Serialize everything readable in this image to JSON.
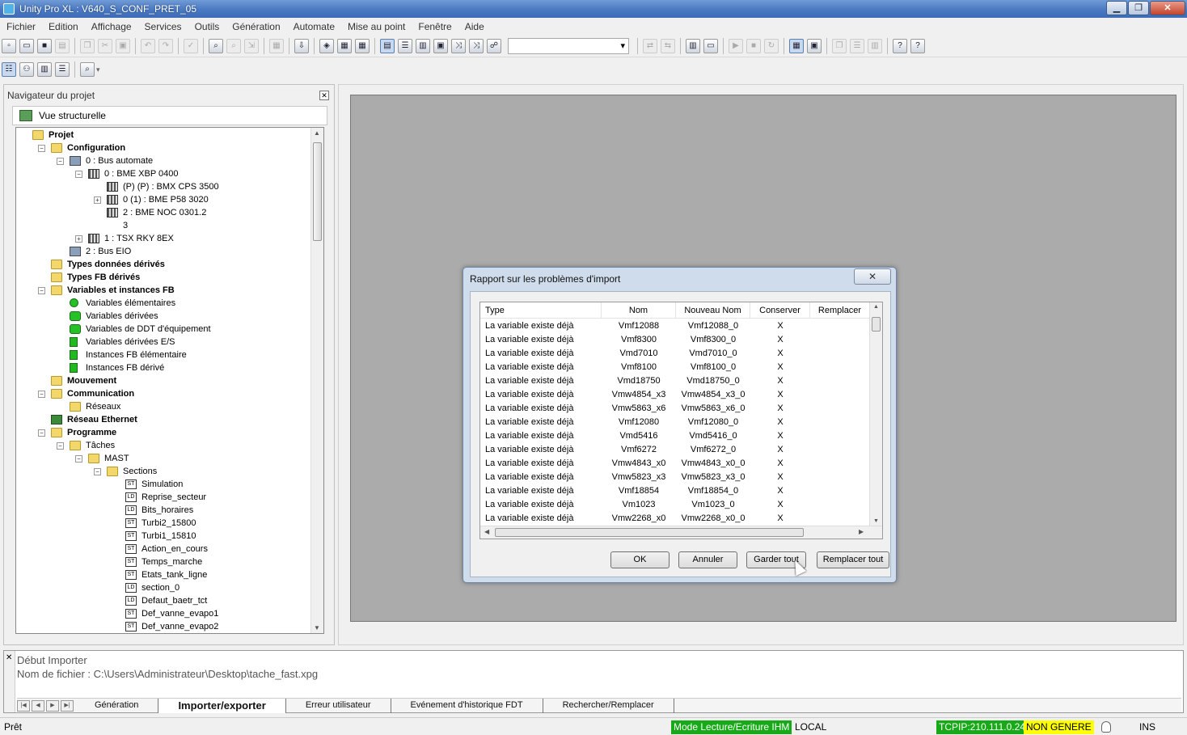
{
  "window": {
    "title": "Unity Pro XL : V640_S_CONF_PRET_05"
  },
  "menu": [
    "Fichier",
    "Edition",
    "Affichage",
    "Services",
    "Outils",
    "Génération",
    "Automate",
    "Mise au point",
    "Fenêtre",
    "Aide"
  ],
  "navigator": {
    "title": "Navigateur du projet",
    "view": "Vue structurelle",
    "tree": [
      {
        "label": "Projet",
        "level": 0,
        "icon": "folder",
        "bold": true
      },
      {
        "label": "Configuration",
        "level": 1,
        "icon": "folder",
        "bold": true,
        "exp": "-"
      },
      {
        "label": "0 : Bus automate",
        "level": 2,
        "icon": "bus",
        "exp": "-"
      },
      {
        "label": "0 : BME XBP 0400",
        "level": 3,
        "icon": "rack",
        "exp": "-"
      },
      {
        "label": "(P) (P) : BMX CPS 3500",
        "level": 4,
        "icon": "rack"
      },
      {
        "label": "0 (1) : BME P58 3020",
        "level": 4,
        "icon": "rack",
        "exp": "+"
      },
      {
        "label": "2 : BME NOC 0301.2",
        "level": 4,
        "icon": "rack"
      },
      {
        "label": "3",
        "level": 4,
        "icon": "none"
      },
      {
        "label": "1 : TSX RKY 8EX",
        "level": 3,
        "icon": "rack",
        "exp": "+"
      },
      {
        "label": "2 : Bus EIO",
        "level": 2,
        "icon": "bus"
      },
      {
        "label": "Types données dérivés",
        "level": 1,
        "icon": "folder",
        "bold": true
      },
      {
        "label": "Types FB dérivés",
        "level": 1,
        "icon": "folder",
        "bold": true
      },
      {
        "label": "Variables et instances FB",
        "level": 1,
        "icon": "folder",
        "bold": true,
        "exp": "-"
      },
      {
        "label": "Variables élémentaires",
        "level": 2,
        "icon": "greenc"
      },
      {
        "label": "Variables dérivées",
        "level": 2,
        "icon": "greenr"
      },
      {
        "label": "Variables de DDT d'équipement",
        "level": 2,
        "icon": "greenr"
      },
      {
        "label": "Variables dérivées E/S",
        "level": 2,
        "icon": "greens"
      },
      {
        "label": "Instances FB élémentaire",
        "level": 2,
        "icon": "greens"
      },
      {
        "label": "Instances FB dérivé",
        "level": 2,
        "icon": "greens"
      },
      {
        "label": "Mouvement",
        "level": 1,
        "icon": "folder",
        "bold": true
      },
      {
        "label": "Communication",
        "level": 1,
        "icon": "folder",
        "bold": true,
        "exp": "-"
      },
      {
        "label": "Réseaux",
        "level": 2,
        "icon": "folder"
      },
      {
        "label": "Réseau Ethernet",
        "level": 1,
        "icon": "net",
        "bold": true
      },
      {
        "label": "Programme",
        "level": 1,
        "icon": "folder",
        "bold": true,
        "exp": "-"
      },
      {
        "label": "Tâches",
        "level": 2,
        "icon": "folder",
        "exp": "-"
      },
      {
        "label": "MAST",
        "level": 3,
        "icon": "folder",
        "exp": "-"
      },
      {
        "label": "Sections",
        "level": 4,
        "icon": "folder",
        "exp": "-"
      },
      {
        "label": "Simulation",
        "level": 5,
        "icon": "ST"
      },
      {
        "label": "Reprise_secteur",
        "level": 5,
        "icon": "LD"
      },
      {
        "label": "Bits_horaires",
        "level": 5,
        "icon": "LD"
      },
      {
        "label": "Turbi2_15800",
        "level": 5,
        "icon": "ST"
      },
      {
        "label": "Turbi1_15810",
        "level": 5,
        "icon": "ST"
      },
      {
        "label": "Action_en_cours",
        "level": 5,
        "icon": "ST"
      },
      {
        "label": "Temps_marche",
        "level": 5,
        "icon": "ST"
      },
      {
        "label": "Etats_tank_ligne",
        "level": 5,
        "icon": "ST"
      },
      {
        "label": "section_0",
        "level": 5,
        "icon": "LD"
      },
      {
        "label": "Defaut_baetr_tct",
        "level": 5,
        "icon": "LD"
      },
      {
        "label": "Def_vanne_evapo1",
        "level": 5,
        "icon": "ST"
      },
      {
        "label": "Def_vanne_evapo2",
        "level": 5,
        "icon": "ST"
      }
    ]
  },
  "dialog": {
    "title": "Rapport sur les problèmes d'import",
    "close": "✕",
    "columns": [
      "Type",
      "Nom",
      "Nouveau Nom",
      "Conserver",
      "Remplacer"
    ],
    "rows": [
      [
        "La variable existe déjà",
        "Vmf12088",
        "Vmf12088_0",
        "X",
        ""
      ],
      [
        "La variable existe déjà",
        "Vmf8300",
        "Vmf8300_0",
        "X",
        ""
      ],
      [
        "La variable existe déjà",
        "Vmd7010",
        "Vmd7010_0",
        "X",
        ""
      ],
      [
        "La variable existe déjà",
        "Vmf8100",
        "Vmf8100_0",
        "X",
        ""
      ],
      [
        "La variable existe déjà",
        "Vmd18750",
        "Vmd18750_0",
        "X",
        ""
      ],
      [
        "La variable existe déjà",
        "Vmw4854_x3",
        "Vmw4854_x3_0",
        "X",
        ""
      ],
      [
        "La variable existe déjà",
        "Vmw5863_x6",
        "Vmw5863_x6_0",
        "X",
        ""
      ],
      [
        "La variable existe déjà",
        "Vmf12080",
        "Vmf12080_0",
        "X",
        ""
      ],
      [
        "La variable existe déjà",
        "Vmd5416",
        "Vmd5416_0",
        "X",
        ""
      ],
      [
        "La variable existe déjà",
        "Vmf6272",
        "Vmf6272_0",
        "X",
        ""
      ],
      [
        "La variable existe déjà",
        "Vmw4843_x0",
        "Vmw4843_x0_0",
        "X",
        ""
      ],
      [
        "La variable existe déjà",
        "Vmw5823_x3",
        "Vmw5823_x3_0",
        "X",
        ""
      ],
      [
        "La variable existe déjà",
        "Vmf18854",
        "Vmf18854_0",
        "X",
        ""
      ],
      [
        "La variable existe déjà",
        "Vm1023",
        "Vm1023_0",
        "X",
        ""
      ],
      [
        "La variable existe déjà",
        "Vmw2268_x0",
        "Vmw2268_x0_0",
        "X",
        ""
      ]
    ],
    "buttons": {
      "ok": "OK",
      "cancel": "Annuler",
      "keep_all": "Garder tout",
      "replace_all": "Remplacer tout"
    }
  },
  "output": {
    "line1": "Début Importer",
    "line2": "Nom de fichier : C:\\Users\\Administrateur\\Desktop\\tache_fast.xpg",
    "tabs": [
      "Génération",
      "Importer/exporter",
      "Erreur utilisateur",
      "Evénement d'historique FDT",
      "Rechercher/Remplacer"
    ]
  },
  "status": {
    "ready": "Prêt",
    "mode": "Mode Lecture/Ecriture IHM",
    "local": "LOCAL",
    "tcp": "TCPIP:210.111.0.24",
    "gen": "NON GENERE",
    "ins": "INS"
  },
  "colors": {
    "title_bar": "#4b79c2",
    "status_green": "#17a917",
    "status_yellow": "#ffff00",
    "mdi_bg": "#ababab"
  }
}
